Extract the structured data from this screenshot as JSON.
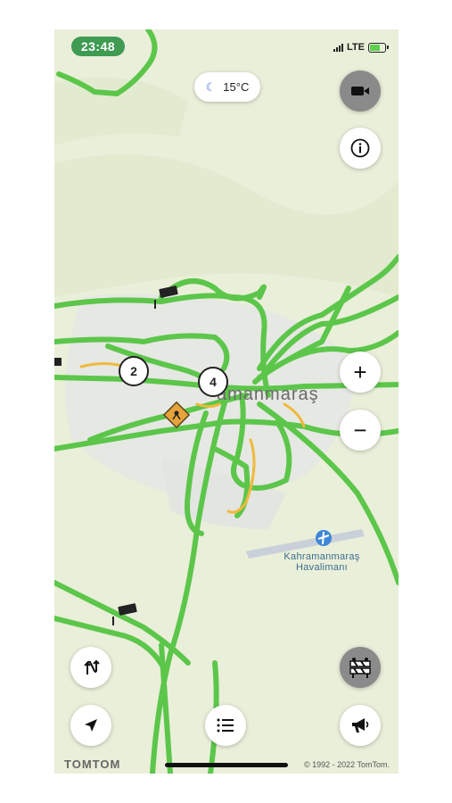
{
  "status_bar": {
    "time": "23:48",
    "network": "LTE"
  },
  "weather": {
    "icon": "moon-icon",
    "temperature": "15°C"
  },
  "map": {
    "city_label": "amanmaraş",
    "airport_name_line1": "Kahramanmaraş",
    "airport_name_line2": "Havalimanı",
    "cluster_pins": [
      "2",
      "4"
    ]
  },
  "controls": {
    "camera_icon": "camera-icon",
    "info_icon": "info-icon",
    "zoom_in": "+",
    "zoom_out": "−",
    "route_icon": "route-icon",
    "locate_icon": "navigation-arrow-icon",
    "list_icon": "list-icon",
    "roadblock_icon": "roadblock-icon",
    "report_icon": "megaphone-icon"
  },
  "footer": {
    "brand": "TOMTOM",
    "copyright": "© 1992 - 2022 TomTom."
  },
  "colors": {
    "traffic_free": "#5cc64a",
    "traffic_slow": "#f0b93a",
    "map_bg": "#e9efd9",
    "clock_bg": "#3f9a52"
  }
}
